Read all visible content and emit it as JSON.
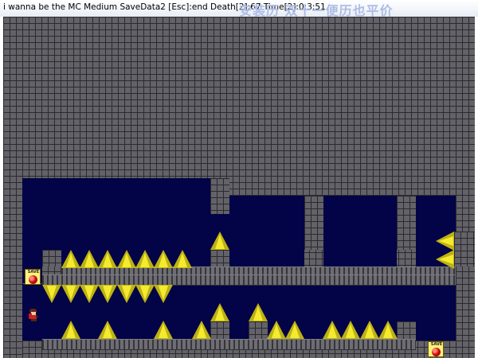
{
  "window": {
    "title": "i wanna be the MC Medium  SaveData2   [Esc]:end Death[2]:67 Time[2]:0:3:51",
    "title_watermark": "安装历 双十一便历也平价"
  },
  "hud": {
    "game_name": "i wanna be the MC Medium",
    "save_slot": "SaveData2",
    "escape_hint": "[Esc]:end",
    "death_count": 67,
    "play_time": "0:3:51"
  },
  "level": {
    "theme_colors": {
      "brick": "#626268",
      "mortar": "#2a2a2f",
      "void": "#030347",
      "spike_light": "#f4ea2e",
      "spike_dark": "#bdb215",
      "save_box": "#fff27a",
      "save_orb": "#d21010"
    },
    "save_points": [
      {
        "label": "SAVE",
        "icon": "save-point-icon"
      },
      {
        "label": "SAVE",
        "icon": "save-point-icon"
      }
    ],
    "player": {
      "icon": "player-kid-icon"
    },
    "hazard_icon": "spike-icon"
  }
}
